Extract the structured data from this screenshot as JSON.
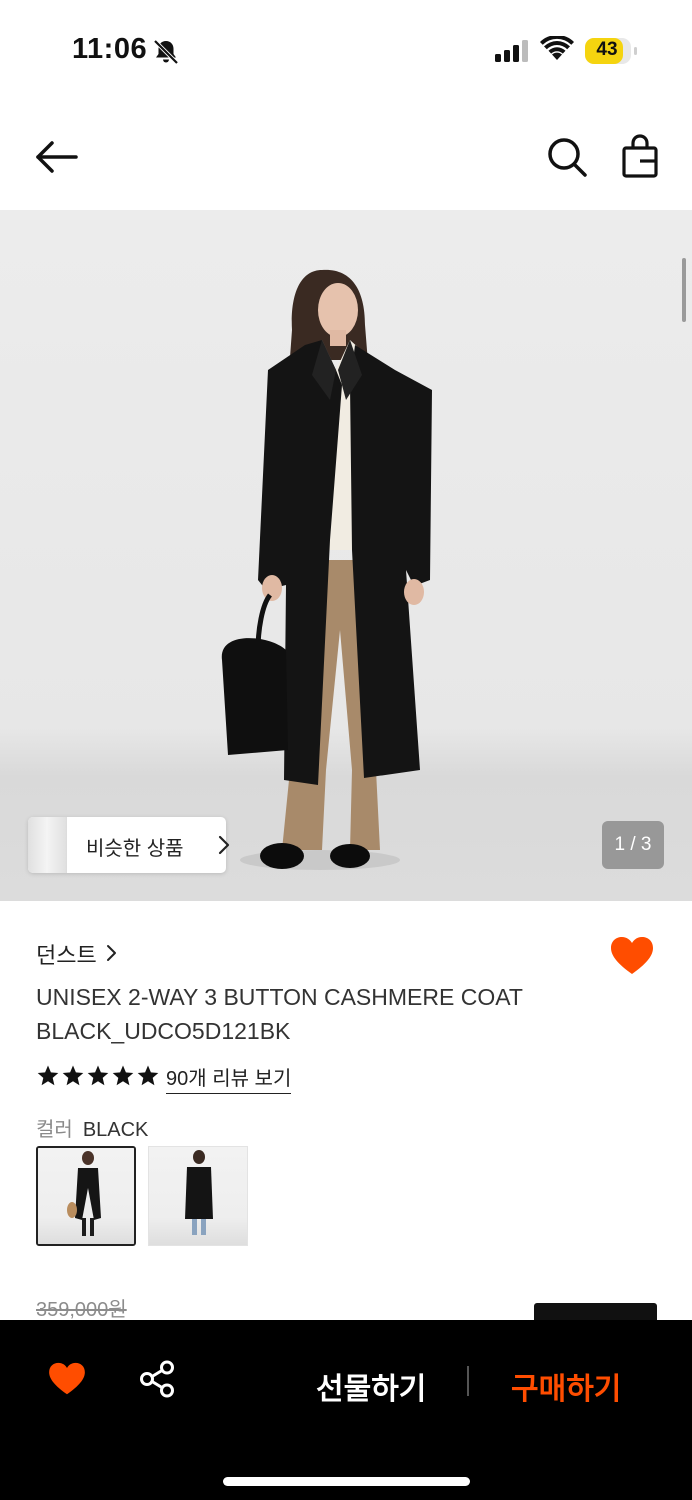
{
  "status_bar": {
    "time": "11:06",
    "battery": "43"
  },
  "gallery": {
    "similar_label": "비슷한 상품",
    "counter": "1 / 3"
  },
  "product": {
    "brand": "던스트",
    "title_line1": "UNISEX 2-WAY 3 BUTTON CASHMERE COAT",
    "title_line2": "BLACK_UDCO5D121BK",
    "rating": 5,
    "reviews_label": "90개 리뷰 보기",
    "color_key": "컬러",
    "color_value": "BLACK",
    "original_price": "359,000원"
  },
  "bottom_bar": {
    "gift_label": "선물하기",
    "buy_label": "구매하기"
  },
  "colors": {
    "accent": "#ff4d00",
    "bar": "#000000"
  },
  "icons": [
    "back-arrow-icon",
    "search-icon",
    "shopping-bag-icon",
    "heart-icon",
    "share-icon",
    "star-icon",
    "chevron-right-icon",
    "bell-slash-icon",
    "signal-icon",
    "wifi-icon",
    "battery-icon"
  ]
}
